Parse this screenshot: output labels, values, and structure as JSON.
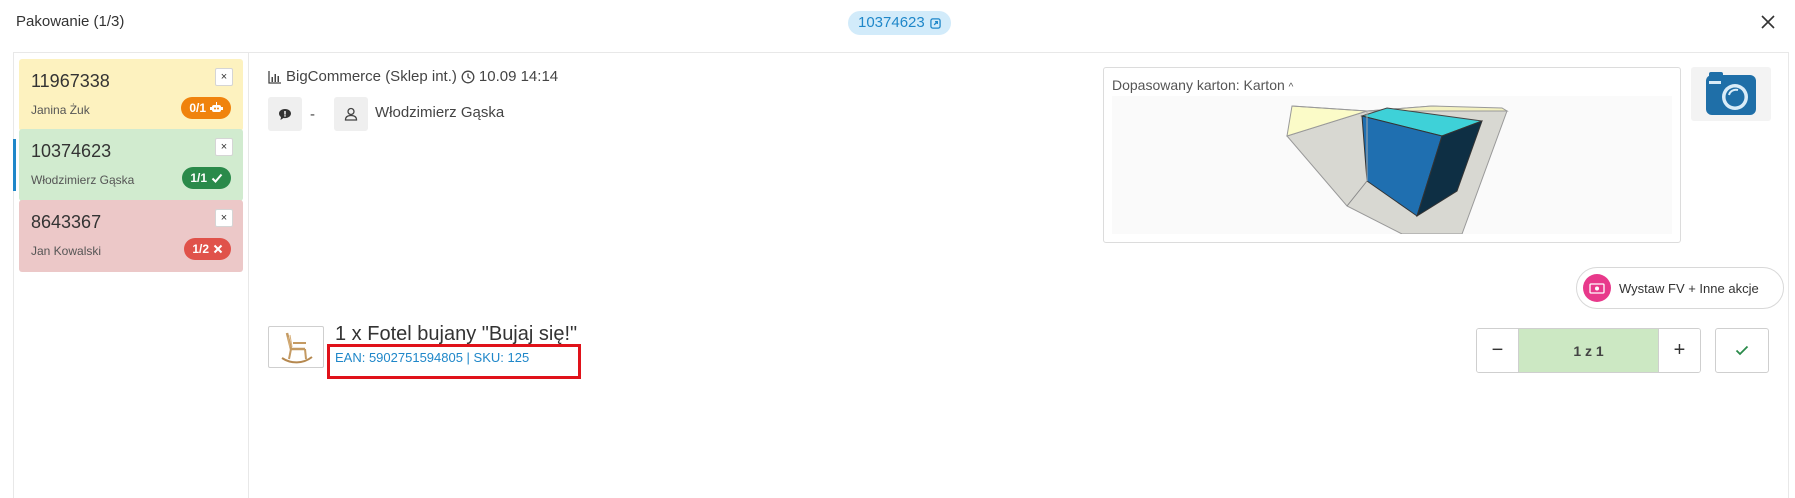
{
  "header": {
    "title": "Pakowanie  (1/3)",
    "order_badge": "10374623",
    "close_icon": "close-icon"
  },
  "orders": [
    {
      "number": "11967338",
      "customer": "Janina Żuk",
      "status": "0/1",
      "status_icon": "robot-icon",
      "color": "#fdf2bf",
      "badge_color": "#f0830d",
      "remove": "×"
    },
    {
      "number": "10374623",
      "customer": "Włodzimierz Gąska",
      "status": "1/1",
      "status_icon": "check-icon",
      "color": "#d1ebcf",
      "badge_color": "#2a8a4a",
      "remove": "×",
      "active": true
    },
    {
      "number": "8643367",
      "customer": "Jan Kowalski",
      "status": "1/2",
      "status_icon": "x-icon",
      "color": "#ecc8c8",
      "badge_color": "#e0524a",
      "remove": "×"
    }
  ],
  "order_meta": {
    "source": "BigCommerce (Sklep int.)",
    "datetime": "10.09 14:14",
    "comment": "-",
    "assignee": "Włodzimierz Gąska"
  },
  "carton": {
    "label": "Dopasowany karton: Karton",
    "chevron": "^"
  },
  "actions": {
    "label": "Wystaw FV + Inne akcje"
  },
  "product": {
    "name": "1 x Fotel bujany \"Bujaj się!\"",
    "codes": "EAN: 5902751594805 | SKU: 125",
    "quantity": "1 z 1",
    "minus": "−",
    "plus": "+"
  },
  "colors": {
    "accent": "#1f87c9",
    "highlight": "#e0121a",
    "qty_bg": "#cce8c3"
  }
}
